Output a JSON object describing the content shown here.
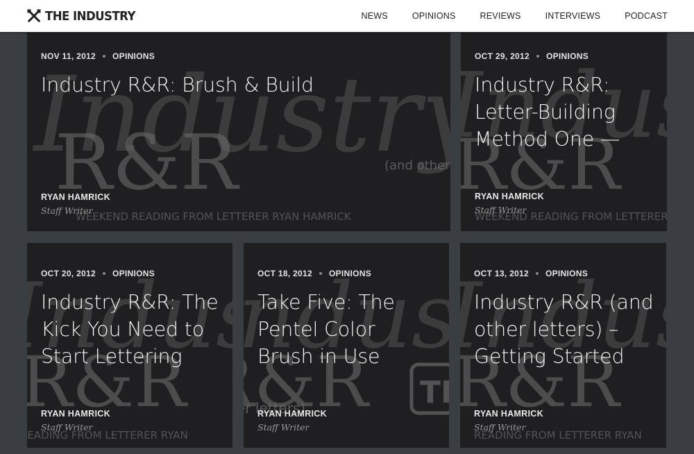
{
  "brand": {
    "name": "THE INDUSTRY"
  },
  "nav": [
    "NEWS",
    "OPINIONS",
    "REVIEWS",
    "INTERVIEWS",
    "PODCAST"
  ],
  "cards": [
    {
      "date": "NOV 11, 2012",
      "category": "OPINIONS",
      "title": "Industry R&R: Brush & Build",
      "author": "RYAN HAMRICK",
      "role": "Staff Writer"
    },
    {
      "date": "OCT 29, 2012",
      "category": "OPINIONS",
      "title": "Industry R&R: Letter-Building Method One —",
      "author": "RYAN HAMRICK",
      "role": "Staff Writer"
    },
    {
      "date": "OCT 20, 2012",
      "category": "OPINIONS",
      "title": "Industry R&R: The Kick You Need to Start Lettering",
      "author": "RYAN HAMRICK",
      "role": "Staff Writer"
    },
    {
      "date": "OCT 18, 2012",
      "category": "OPINIONS",
      "title": "Take Five: The Pentel Color Brush in Use",
      "author": "RYAN HAMRICK",
      "role": "Staff Writer"
    },
    {
      "date": "OCT 13, 2012",
      "category": "OPINIONS",
      "title": "Industry R&R (and other letters) – Getting Started",
      "author": "RYAN HAMRICK",
      "role": "Staff Writer"
    }
  ],
  "background_art": {
    "script": "Industry",
    "monogram": "R&R",
    "aside": "(and other",
    "aside_2": "er letters)",
    "tagline": "WEEKEND READING FROM LETTERER RYAN HAMRICK",
    "tagline_short": "READING FROM LETTERER RYAN",
    "badge": "TI"
  }
}
